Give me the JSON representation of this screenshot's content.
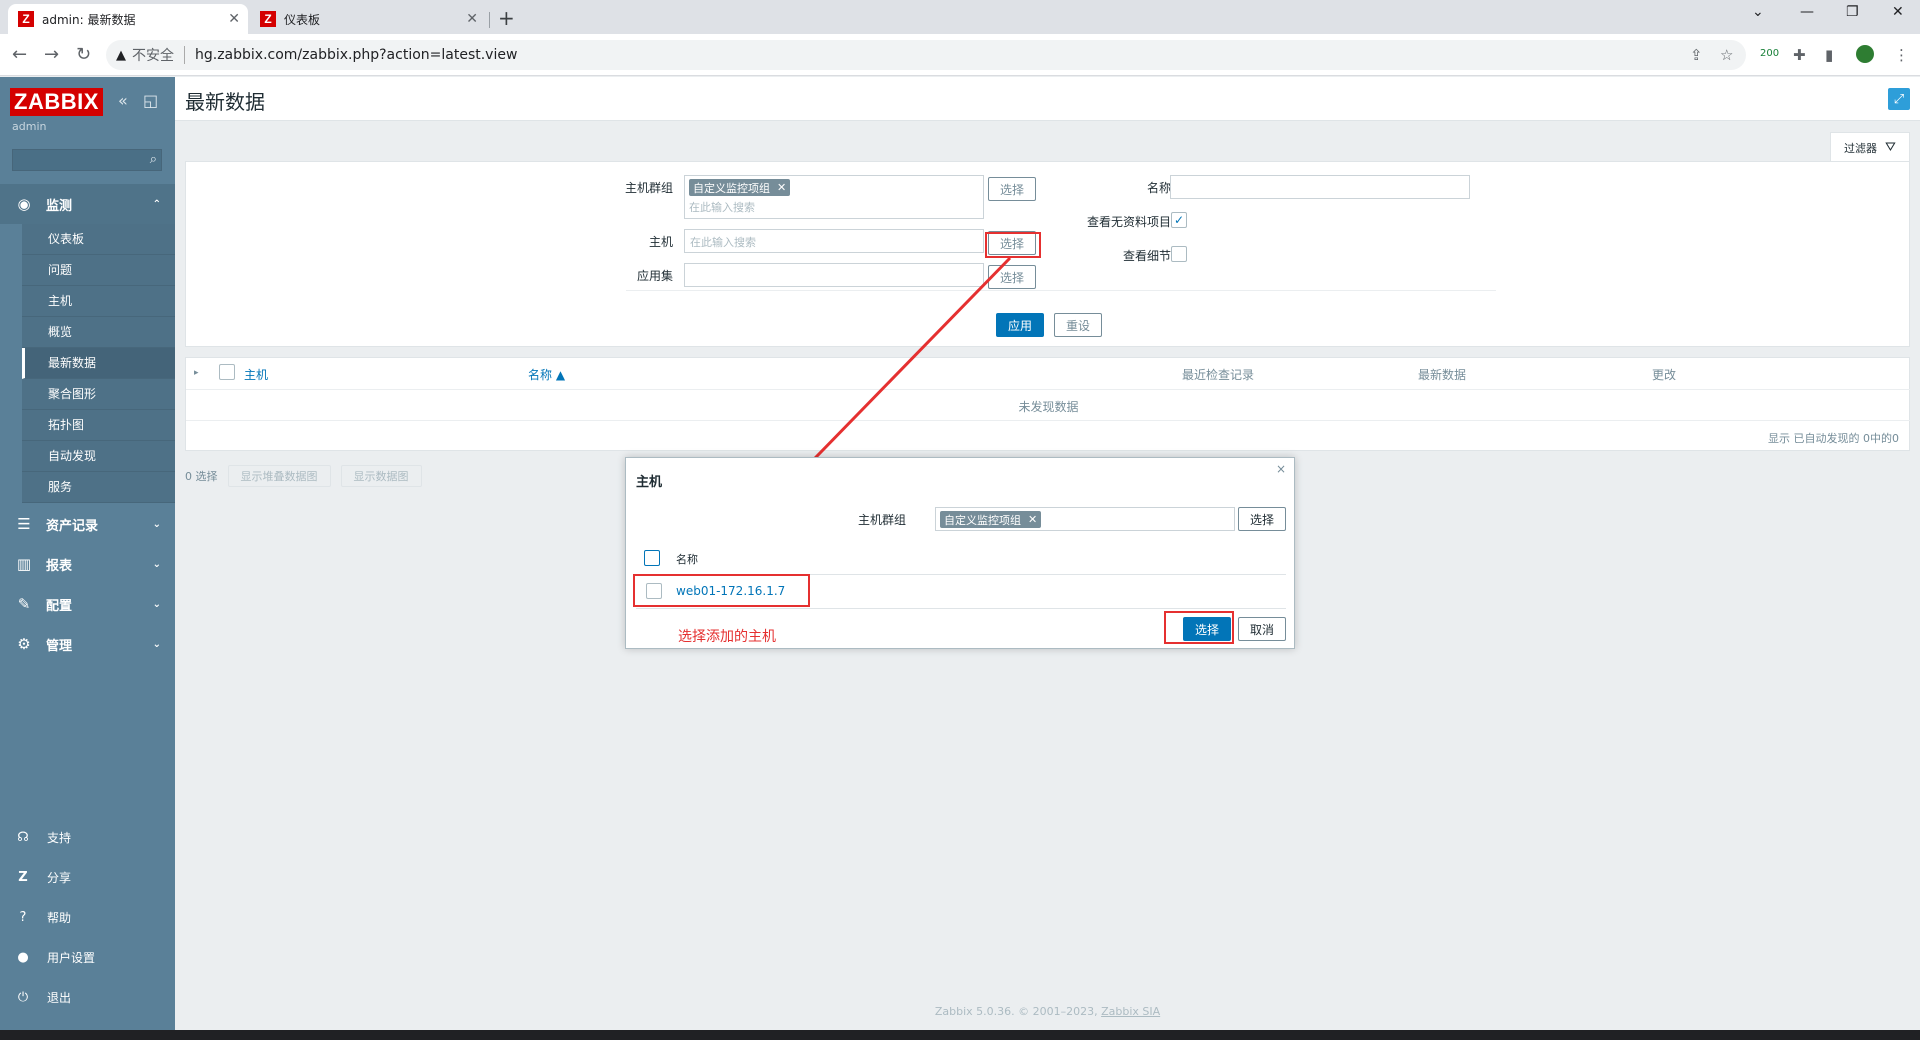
{
  "browser": {
    "tabs": [
      {
        "title": "admin: 最新数据",
        "icon": "Z"
      },
      {
        "title": "仪表板",
        "icon": "Z"
      }
    ],
    "new_tab": "+",
    "insecure_label": "不安全",
    "url": "hg.zabbix.com/zabbix.php?action=latest.view",
    "extension_badge": "200"
  },
  "sidebar": {
    "logo": "ZABBIX",
    "user": "admin",
    "sections": [
      {
        "label": "监测",
        "icon": "eye-icon"
      },
      {
        "label": "资产记录",
        "icon": "list-icon"
      },
      {
        "label": "报表",
        "icon": "chart-icon"
      },
      {
        "label": "配置",
        "icon": "wrench-icon"
      },
      {
        "label": "管理",
        "icon": "gear-icon"
      }
    ],
    "monitoring_items": [
      "仪表板",
      "问题",
      "主机",
      "概览",
      "最新数据",
      "聚合图形",
      "拓扑图",
      "自动发现",
      "服务"
    ],
    "footer": [
      {
        "label": "支持",
        "icon": "headset-icon"
      },
      {
        "label": "分享",
        "icon": "share-icon"
      },
      {
        "label": "帮助",
        "icon": "help-icon"
      },
      {
        "label": "用户设置",
        "icon": "user-icon"
      },
      {
        "label": "退出",
        "icon": "power-icon"
      }
    ]
  },
  "page": {
    "title": "最新数据",
    "filter_tab": "过滤器"
  },
  "filter": {
    "host_group_label": "主机群组",
    "host_group_tag": "自定义监控项组",
    "search_placeholder": "在此输入搜索",
    "select_label": "选择",
    "host_label": "主机",
    "app_label": "应用集",
    "name_label": "名称",
    "show_no_data_label": "查看无资料项目",
    "show_details_label": "查看细节",
    "apply": "应用",
    "reset": "重设"
  },
  "table": {
    "headers": [
      "主机",
      "名称 ▲",
      "最近检查记录",
      "最新数据",
      "更改"
    ],
    "no_data": "未发现数据",
    "summary": "显示 已自动发现的 0中的0",
    "selected_count": "0 选择",
    "btn_stacked_graph": "显示堆叠数据图",
    "btn_graph": "显示数据图"
  },
  "dialog": {
    "title": "主机",
    "close": "×",
    "host_group_label": "主机群组",
    "host_group_tag": "自定义监控项组",
    "select": "选择",
    "col_name": "名称",
    "host": "web01-172.16.1.7",
    "btn_select": "选择",
    "btn_cancel": "取消"
  },
  "annotation": {
    "text": "选择添加的主机",
    "color": "#e53030"
  },
  "footer": {
    "text": "Zabbix 5.0.36. © 2001–2023,",
    "link": "Zabbix SIA"
  },
  "colors": {
    "sidebar": "#5a8098",
    "primary": "#0275b8",
    "logo": "#d40000"
  }
}
